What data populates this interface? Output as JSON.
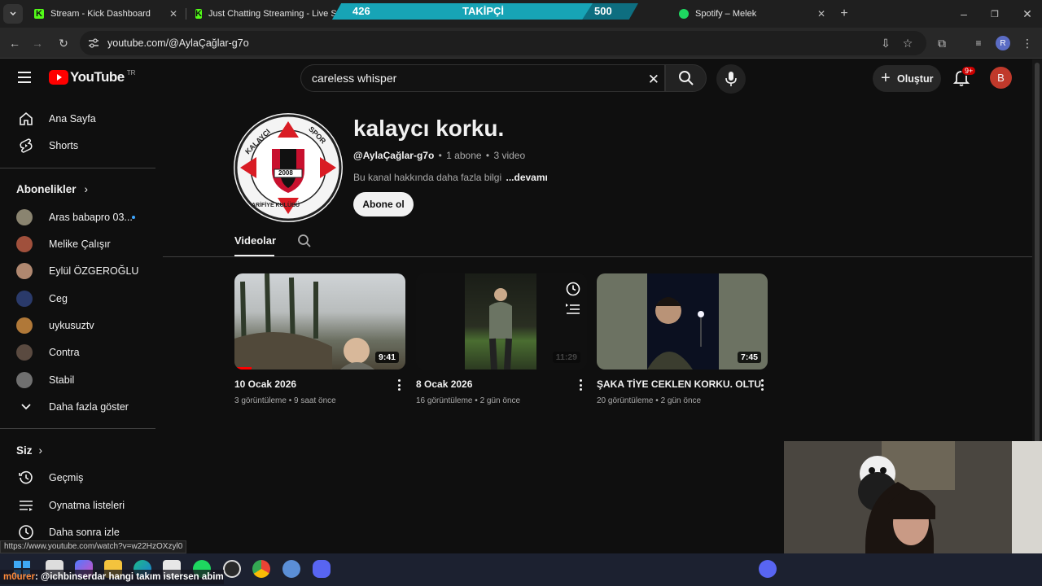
{
  "browser": {
    "tabs": [
      {
        "label": "Stream - Kick Dashboard",
        "icon": "kick-icon"
      },
      {
        "label": "Just Chatting Streaming - Live S",
        "icon": "kick-icon"
      },
      {
        "label": "Spotify – Melek",
        "icon": "spotify-icon"
      }
    ],
    "url": "youtube.com/@AylaÇağlar-g7o",
    "status_url": "https://www.youtube.com/watch?v=w22HzOXzyl0",
    "profile_initial": "R"
  },
  "overlay": {
    "follow_label": "TAKİPÇİ",
    "follow_current": "426",
    "follow_goal": "500",
    "follow_progress": 0.852,
    "chat_user": "m0urer",
    "chat_message": ": @ichbinserdar hangi takım istersen abim"
  },
  "youtube": {
    "logo_text": "YouTube",
    "region": "TR",
    "search_value": "careless whisper",
    "create_label": "Oluştur",
    "notif_badge": "9+",
    "avatar_initial": "B"
  },
  "sidebar": {
    "home": "Ana Sayfa",
    "shorts": "Shorts",
    "subs_title": "Abonelikler",
    "subscriptions": [
      {
        "name": "Aras babapro 03...",
        "color": "#8a8470",
        "new": true
      },
      {
        "name": "Melike Çalışır",
        "color": "#a0503c",
        "new": false
      },
      {
        "name": "Eylül ÖZGEROĞLU",
        "color": "#b08870",
        "new": false
      },
      {
        "name": "Ceg",
        "color": "#2a3a6a",
        "new": false
      },
      {
        "name": "uykusuztv",
        "color": "#b07838",
        "new": false
      },
      {
        "name": "Contra",
        "color": "#5a4a40",
        "new": false
      },
      {
        "name": "Stabil",
        "color": "#707070",
        "new": false
      }
    ],
    "show_more": "Daha fazla göster",
    "you_title": "Siz",
    "history": "Geçmiş",
    "playlists": "Oynatma listeleri",
    "watch_later": "Daha sonra izle"
  },
  "channel": {
    "name": "kalaycı korku.",
    "handle": "@AylaÇağlar-g7o",
    "subscribers": "1 abone",
    "video_count": "3 video",
    "description": "Bu kanal hakkında daha fazla bilgi",
    "more": "...devamı",
    "subscribe_label": "Abone ol",
    "logo_text_top_left": "KALAYCI",
    "logo_text_top_right": "SPOR",
    "logo_text_bottom": "ARİFİYE KULÜBÜ",
    "logo_year": "2008",
    "tab_videos": "Videolar"
  },
  "videos": [
    {
      "title": "10 Ocak 2026",
      "views": "3 görüntüleme",
      "age": "9 saat önce",
      "duration": "9:41",
      "progress": 0.1
    },
    {
      "title": "8 Ocak 2026",
      "views": "16 görüntüleme",
      "age": "2 gün önce",
      "duration": "11:29",
      "progress": 0
    },
    {
      "title": "ŞAKA TİYE CEKLEN KORKU. OLTU",
      "views": "20 görüntüleme",
      "age": "2 gün önce",
      "duration": "7:45",
      "progress": 0
    }
  ],
  "meta_separator": "•"
}
